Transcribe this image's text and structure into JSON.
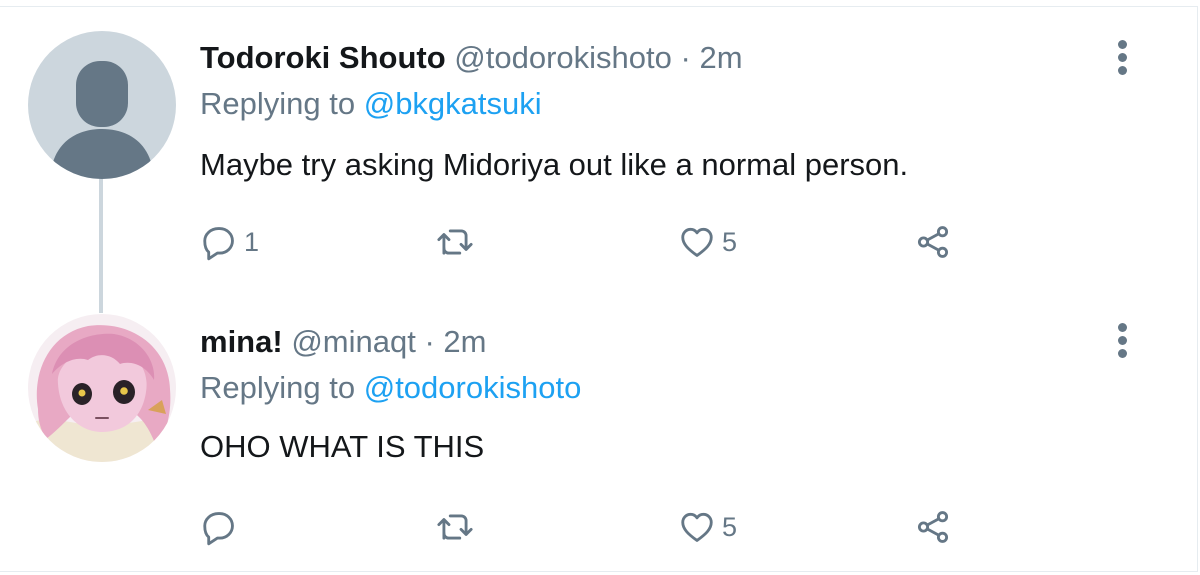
{
  "tweets": [
    {
      "author_name": "Todoroki Shouto",
      "author_handle": "@todorokishoto",
      "separator": "·",
      "time": "2m",
      "replying_prefix": "Replying to",
      "replying_to": "@bkgkatsuki",
      "text": "Maybe try asking Midoriya out like a normal person.",
      "reply_count": "1",
      "like_count": "5"
    },
    {
      "author_name": "mina!",
      "author_handle": "@minaqt",
      "separator": "·",
      "time": "2m",
      "replying_prefix": "Replying to",
      "replying_to": "@todorokishoto",
      "text": "OHO WHAT IS THIS",
      "reply_count": "",
      "like_count": "5"
    }
  ],
  "icons": {
    "reply": "reply-icon",
    "retweet": "retweet-icon",
    "like": "heart-icon",
    "share": "share-icon",
    "more": "more-vertical-icon"
  },
  "colors": {
    "text": "#14171a",
    "secondary": "#657786",
    "link": "#1da1f2",
    "thread_line": "#ccd6dd",
    "placeholder_avatar_bg": "#ccd6dd",
    "placeholder_avatar_fg": "#657786"
  }
}
